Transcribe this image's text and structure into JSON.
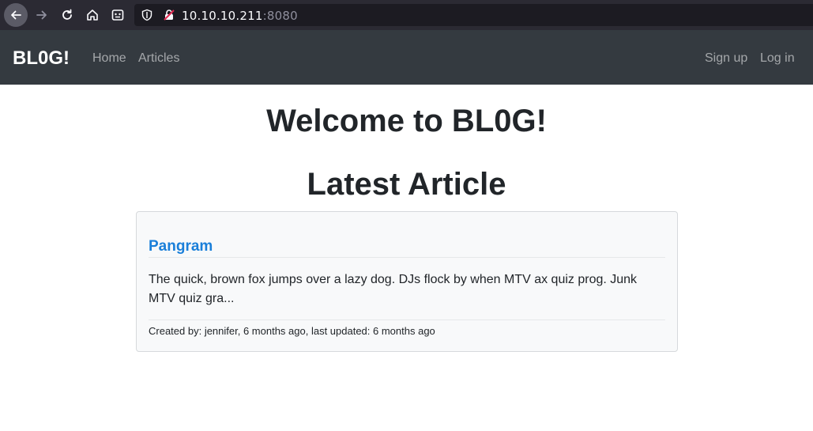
{
  "browser": {
    "url_host": "10.10.10.211",
    "url_port": ":8080"
  },
  "navbar": {
    "brand": "BL0G!",
    "links": [
      "Home",
      "Articles"
    ],
    "right_links": [
      "Sign up",
      "Log in"
    ]
  },
  "main": {
    "heading": "Welcome to BL0G!",
    "subheading": "Latest Article",
    "article": {
      "title": "Pangram",
      "excerpt": "The quick, brown fox jumps over a lazy dog. DJs flock by when MTV ax quiz prog. Junk MTV quiz gra...",
      "meta": "Created by: jennifer, 6 months ago, last updated: 6 months ago"
    }
  },
  "colors": {
    "navbar_bg": "#343a40",
    "link": "#1a7fd9",
    "card_bg": "#f8f9fa"
  }
}
